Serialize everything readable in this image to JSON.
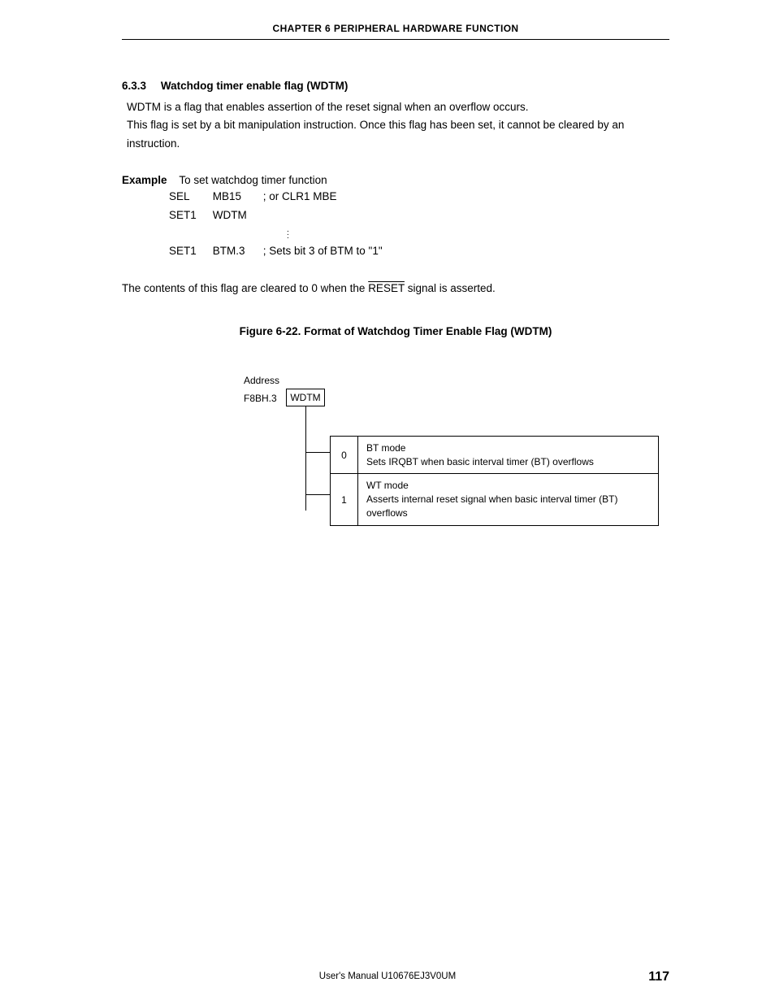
{
  "header": {
    "chapter": "CHAPTER 6   PERIPHERAL HARDWARE FUNCTION"
  },
  "section": {
    "number": "6.3.3",
    "title": "Watchdog timer enable flag (WDTM)",
    "para1": "WDTM is a flag that enables assertion of the reset signal when an overflow occurs.",
    "para2": "This flag is set by a bit manipulation instruction.  Once this flag has been set, it cannot be cleared by an instruction."
  },
  "example": {
    "label": "Example",
    "lead_in": "To set watchdog timer function",
    "rows": [
      {
        "op": "SEL",
        "arg": "MB15",
        "cmt": "; or CLR1 MBE"
      },
      {
        "op": "SET1",
        "arg": "WDTM",
        "cmt": ""
      },
      {
        "op": "SET1",
        "arg": "BTM.3",
        "cmt": "; Sets bit 3 of BTM to \"1\""
      }
    ]
  },
  "contents": {
    "pre": "The contents of this flag are cleared to 0 when the ",
    "sig": "RESET",
    "post": " signal is asserted."
  },
  "figure": {
    "title": "Figure 6-22.  Format of Watchdog Timer Enable Flag (WDTM)",
    "address_label": "Address",
    "address": "F8BH.3",
    "flag": "WDTM",
    "rows": [
      {
        "val": "0",
        "txt1": "BT mode",
        "txt2": "Sets IRQBT when basic interval timer (BT) overflows"
      },
      {
        "val": "1",
        "txt1": "WT mode",
        "txt2": "Asserts internal reset signal when basic interval timer (BT) overflows"
      }
    ]
  },
  "footer": {
    "manual": "User's Manual  U10676EJ3V0UM",
    "page": "117"
  }
}
